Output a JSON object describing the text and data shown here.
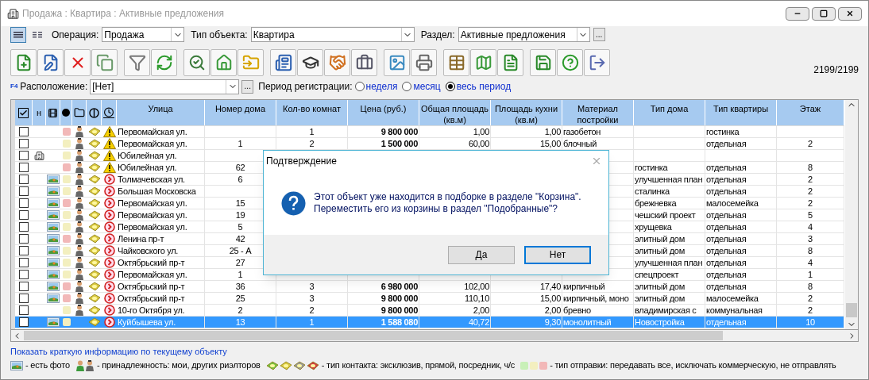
{
  "window": {
    "title": "Продажа : Квартира : Активные предложения"
  },
  "view_modes": [
    {
      "kind": "list",
      "selected": true
    },
    {
      "kind": "columns",
      "selected": false
    }
  ],
  "filters": [
    {
      "label": "Операция:",
      "value": "Продажа",
      "kind": "combo"
    },
    {
      "label": "Тип объекта:",
      "value": "Квартира",
      "kind": "combo"
    },
    {
      "label": "Раздел:",
      "value": "Активные предложения",
      "kind": "combo_more",
      "more": "..."
    }
  ],
  "toolbar": {
    "groups": [
      [
        {
          "kind": "new"
        },
        {
          "kind": "edit"
        },
        {
          "kind": "delete"
        },
        {
          "kind": "copy"
        }
      ],
      [
        {
          "kind": "filter"
        },
        {
          "kind": "refresh"
        }
      ],
      [
        {
          "kind": "house_search"
        },
        {
          "kind": "house"
        },
        {
          "kind": "folders"
        }
      ],
      [
        {
          "kind": "form"
        },
        {
          "kind": "graduate"
        },
        {
          "kind": "handshake"
        },
        {
          "kind": "briefcase"
        }
      ],
      [
        {
          "kind": "picture"
        },
        {
          "kind": "printer"
        }
      ],
      [
        {
          "kind": "table"
        },
        {
          "kind": "map"
        },
        {
          "kind": "document"
        }
      ],
      [
        {
          "kind": "save"
        },
        {
          "kind": "help"
        },
        {
          "kind": "exit"
        }
      ]
    ],
    "counter": "2199/2199"
  },
  "location": {
    "hotkey": "F4",
    "label": "Расположение:",
    "value": "[Нет]",
    "more": "...",
    "period_label": "Период регистрации:",
    "periods": [
      {
        "label": "неделя",
        "selected": false
      },
      {
        "label": "месяц",
        "selected": false
      },
      {
        "label": "весь период",
        "selected": true
      }
    ]
  },
  "table": {
    "icon_columns": [
      {
        "kind": "check"
      },
      {
        "kind": "text",
        "label": "н"
      },
      {
        "kind": "film"
      },
      {
        "kind": "dot"
      },
      {
        "kind": "folder"
      },
      {
        "kind": "contact"
      },
      {
        "kind": "status"
      }
    ],
    "columns": [
      "Улица",
      "Номер дома",
      "Кол-во комнат",
      "Цена (руб.)",
      "Общая площадь (кв.м)",
      "Площадь кухни (кв.м)",
      "Материал постройки",
      "Тип дома",
      "Тип квартиры",
      "Этаж"
    ],
    "rows": [
      {
        "checked": false,
        "building": false,
        "photo": false,
        "color": "#f2b8b8",
        "person": true,
        "kind": "warning",
        "selected": false,
        "cells": [
          "Первомайская ул.",
          null,
          "1",
          "9 800 000",
          "1,00",
          "1,00",
          "газобетон",
          null,
          "гостинка",
          null
        ]
      },
      {
        "checked": false,
        "building": false,
        "photo": false,
        "color": "#f3efbf",
        "person": true,
        "kind": "warning",
        "selected": false,
        "cells": [
          "Первомайская ул.",
          "1",
          "2",
          "1 500 000",
          "60,00",
          "15,00",
          "блочный",
          null,
          "отдельная",
          "2"
        ]
      },
      {
        "checked": false,
        "building": true,
        "photo": false,
        "color": "#f3efbf",
        "person": true,
        "kind": "warning",
        "selected": false,
        "cells": [
          "Юбилейная ул.",
          null,
          null,
          null,
          null,
          null,
          null,
          null,
          null,
          null
        ]
      },
      {
        "checked": false,
        "building": false,
        "photo": false,
        "color": "#f2b8b8",
        "person": true,
        "kind": "warning",
        "selected": false,
        "cells": [
          "Юбилейная ул.",
          "62",
          null,
          null,
          null,
          null,
          null,
          "гостинка",
          "отдельная",
          "8"
        ]
      },
      {
        "checked": false,
        "building": false,
        "photo": true,
        "color": "#f3efbf",
        "person": true,
        "kind": "arrow",
        "selected": false,
        "cells": [
          "Толмачевская ул.",
          "6",
          null,
          null,
          null,
          null,
          null,
          "улучшенная план",
          "отдельная",
          "2"
        ]
      },
      {
        "checked": false,
        "building": false,
        "photo": true,
        "color": "#f3efbf",
        "person": true,
        "kind": "arrow",
        "selected": false,
        "cells": [
          "Большая Московска",
          null,
          null,
          null,
          null,
          null,
          null,
          "сталинка",
          "отдельная",
          "2"
        ]
      },
      {
        "checked": false,
        "building": false,
        "photo": true,
        "color": "#f2b8b8",
        "person": true,
        "kind": "arrow",
        "selected": false,
        "cells": [
          "Первомайская ул.",
          "15",
          null,
          null,
          null,
          null,
          null,
          "брежневка",
          "малосемейка",
          "2"
        ]
      },
      {
        "checked": false,
        "building": false,
        "photo": true,
        "color": "#f3efbf",
        "person": true,
        "kind": "arrow",
        "selected": false,
        "cells": [
          "Первомайская ул.",
          "19",
          null,
          null,
          null,
          null,
          null,
          "чешский проект",
          "отдельная",
          "5"
        ]
      },
      {
        "checked": false,
        "building": false,
        "photo": true,
        "color": "#f3efbf",
        "person": true,
        "kind": "arrow",
        "selected": false,
        "cells": [
          "Первомайская ул.",
          "5",
          null,
          null,
          null,
          null,
          null,
          "хрущевка",
          "отдельная",
          "4"
        ]
      },
      {
        "checked": false,
        "building": false,
        "photo": true,
        "color": "#f2b8b8",
        "person": true,
        "kind": "arrow",
        "selected": false,
        "cells": [
          "Ленина пр-т",
          "42",
          null,
          null,
          null,
          null,
          null,
          "элитный дом",
          "отдельная",
          "3"
        ]
      },
      {
        "checked": false,
        "building": false,
        "photo": true,
        "color": "#f3efbf",
        "person": true,
        "kind": "arrow",
        "selected": false,
        "cells": [
          "Чайковского ул.",
          "25 - А",
          null,
          null,
          null,
          null,
          null,
          "элитный дом",
          "отдельная",
          "8"
        ]
      },
      {
        "checked": false,
        "building": false,
        "photo": true,
        "color": "#f3efbf",
        "person": true,
        "kind": "arrow",
        "selected": false,
        "cells": [
          "Октябрьский пр-т",
          "27",
          null,
          null,
          null,
          null,
          null,
          "улучшенная план",
          "отдельная",
          "4"
        ]
      },
      {
        "checked": false,
        "building": false,
        "photo": true,
        "color": "#f3efbf",
        "person": true,
        "kind": "arrow",
        "selected": false,
        "cells": [
          "Первомайская ул.",
          "1",
          null,
          null,
          null,
          null,
          null,
          "спецпроект",
          "отдельная",
          "1"
        ]
      },
      {
        "checked": false,
        "building": false,
        "photo": true,
        "color": "#f2b8b8",
        "person": true,
        "kind": "arrow",
        "selected": false,
        "cells": [
          "Октябрьский пр-т",
          "36",
          "3",
          "6 980 000",
          "102,00",
          "17,40",
          "кирпичный",
          "элитный дом",
          "отдельная",
          "8"
        ]
      },
      {
        "checked": false,
        "building": false,
        "photo": true,
        "color": "#f2b8b8",
        "person": true,
        "kind": "arrow",
        "selected": false,
        "cells": [
          "Октябрьский пр-т",
          "25",
          "3",
          "9 800 000",
          "110,10",
          "15,00",
          "кирпичный, моно",
          "элитный дом",
          "малосемейка",
          "2"
        ]
      },
      {
        "checked": false,
        "building": false,
        "photo": false,
        "color": "#f3efbf",
        "person": true,
        "kind": "arrow",
        "selected": false,
        "cells": [
          "10-го Октября ул.",
          "2",
          "2",
          "9 800 000",
          "2,00",
          "2,00",
          "бревно",
          "владимирская с",
          "коммунальная",
          "2"
        ]
      },
      {
        "checked": false,
        "building": false,
        "photo": true,
        "color": "#f3efbf",
        "person": false,
        "kind": "arrow",
        "selected": true,
        "cells": [
          "Куйбышева ул.",
          "13",
          "1",
          "1 588 080",
          "40,72",
          "9,30",
          "монолитный",
          "Новостройка",
          "отдельная",
          "10"
        ]
      }
    ]
  },
  "dialog": {
    "title": "Подтверждение",
    "lines": [
      "Этот объект уже находится в подборке в разделе \"Корзина\".",
      "Переместить его из корзины в раздел \"Подобранные\"?"
    ],
    "buttons": [
      {
        "label": "Да",
        "focused": false
      },
      {
        "label": "Нет",
        "focused": true
      }
    ]
  },
  "info_link": "Показать краткую информацию по текущему объекту",
  "legend": [
    {
      "kind": "photo",
      "text": "- есть фото"
    },
    {
      "kind": "owners",
      "text": "- принадлежность: мои, других риэлторов"
    },
    {
      "kind": "contacts",
      "text": "- тип контакта: эксклюзив, прямой, посредник, ч/с"
    },
    {
      "kind": "sending",
      "text": "- тип отправки: передавать все, исключать коммерческую, не отправлять"
    }
  ]
}
